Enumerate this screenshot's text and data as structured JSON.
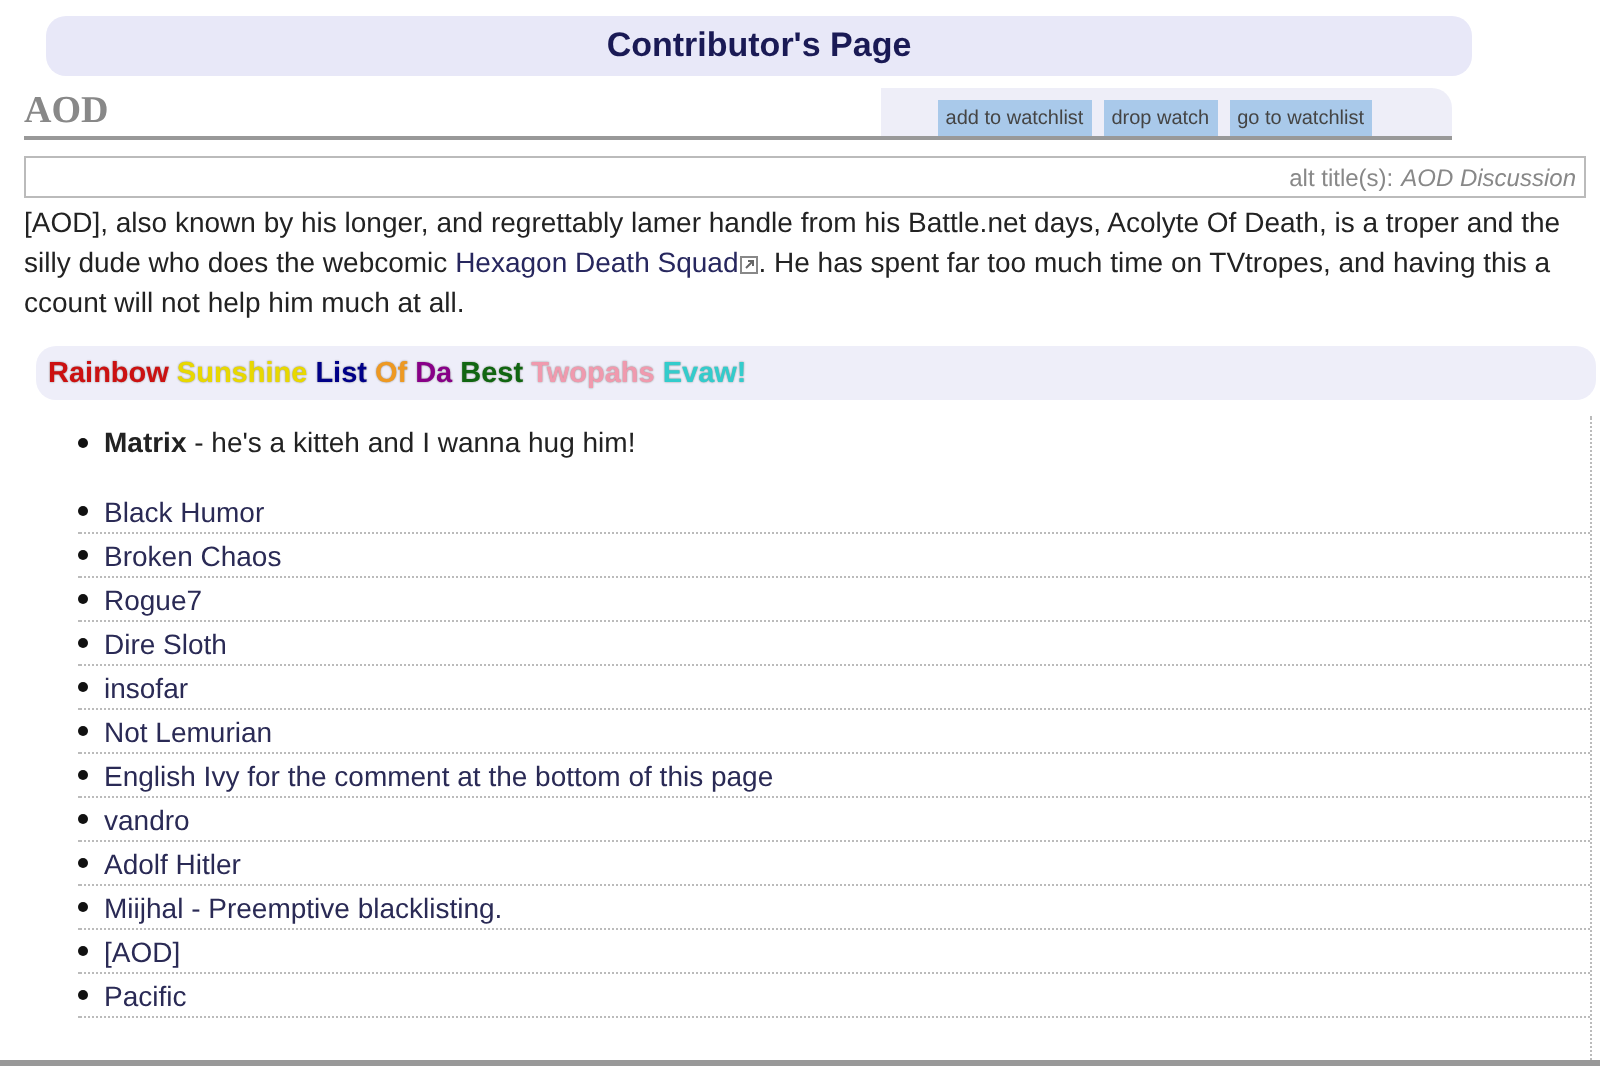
{
  "page_header": {
    "title": "Contributor's Page"
  },
  "article": {
    "title": "AOD",
    "actions": [
      "add to watchlist",
      "drop watch",
      "go to watchlist"
    ]
  },
  "alt_titles": {
    "label": "alt title(s):",
    "value": "AOD Discussion"
  },
  "intro": [
    {
      "text": "[AOD], also known by his longer, and regrettably lamer handle from his Battle.net days, Acolyte Of Death, is a troper and the silly dude who does the webcomic ",
      "link": false
    },
    {
      "text": "Hexagon Death Squad",
      "link": true
    },
    {
      "text": ". He has spent far too much time on TVtropes, and having this account will not help him much at all.",
      "link": false
    }
  ],
  "section_heading": [
    {
      "text": "Rainbow",
      "color": "#cc1111"
    },
    {
      "text": "Sunshine",
      "color": "#e8d800"
    },
    {
      "text": "List",
      "color": "#000088"
    },
    {
      "text": "Of",
      "color": "#ee9922"
    },
    {
      "text": "Da",
      "color": "#880088"
    },
    {
      "text": "Best",
      "color": "#116611"
    },
    {
      "text": "Twopahs",
      "color": "#f09aae"
    },
    {
      "text": "Evaw!",
      "color": "#33cccc"
    }
  ],
  "featured": {
    "name": "Matrix",
    "note": " - he's a kitteh and I wanna hug him!"
  },
  "list": [
    "Black Humor",
    "Broken Chaos",
    "Rogue7",
    "Dire Sloth",
    "insofar",
    "Not Lemurian",
    "English Ivy for the comment at the bottom of this page",
    "vandro",
    "Adolf Hitler",
    "Miijhal - Preemptive blacklisting.",
    "[AOD]",
    "Pacific"
  ]
}
